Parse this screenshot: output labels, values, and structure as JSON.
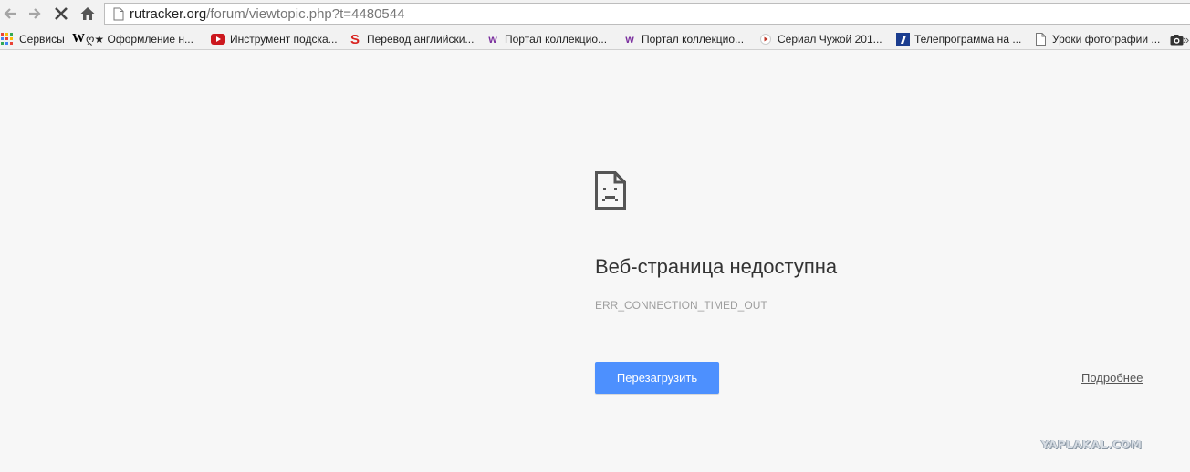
{
  "address_bar": {
    "host": "rutracker.org",
    "path": "/forum/viewtopic.php?t=4480544"
  },
  "bookmarks": [
    {
      "label": "Сервисы",
      "icon": "apps-grid-icon"
    },
    {
      "label": "ღ★ Оформление н...",
      "icon": "wikipedia-w-icon"
    },
    {
      "label": "Инструмент подска...",
      "icon": "youtube-icon"
    },
    {
      "label": "Перевод английски...",
      "icon": "s-logo-icon"
    },
    {
      "label": "Портал коллекцио...",
      "icon": "w-logo-icon"
    },
    {
      "label": "Портал коллекцио...",
      "icon": "w-logo-icon"
    },
    {
      "label": "Сериал Чужой 201...",
      "icon": "play-icon"
    },
    {
      "label": "Телепрограмма на ...",
      "icon": "channel-one-icon"
    },
    {
      "label": "Уроки фотографии ...",
      "icon": "page-icon"
    },
    {
      "label": "",
      "icon": "camera-icon"
    }
  ],
  "error": {
    "title": "Веб-страница недоступна",
    "code": "ERR_CONNECTION_TIMED_OUT",
    "reload_label": "Перезагрузить",
    "details_label": "Подробнее"
  },
  "watermark": "YAPLAKAL.COM",
  "colors": {
    "background": "#f7f7f7",
    "button_blue": "#4d90fe",
    "title_text": "#333333",
    "code_text": "#9e9e9e"
  }
}
